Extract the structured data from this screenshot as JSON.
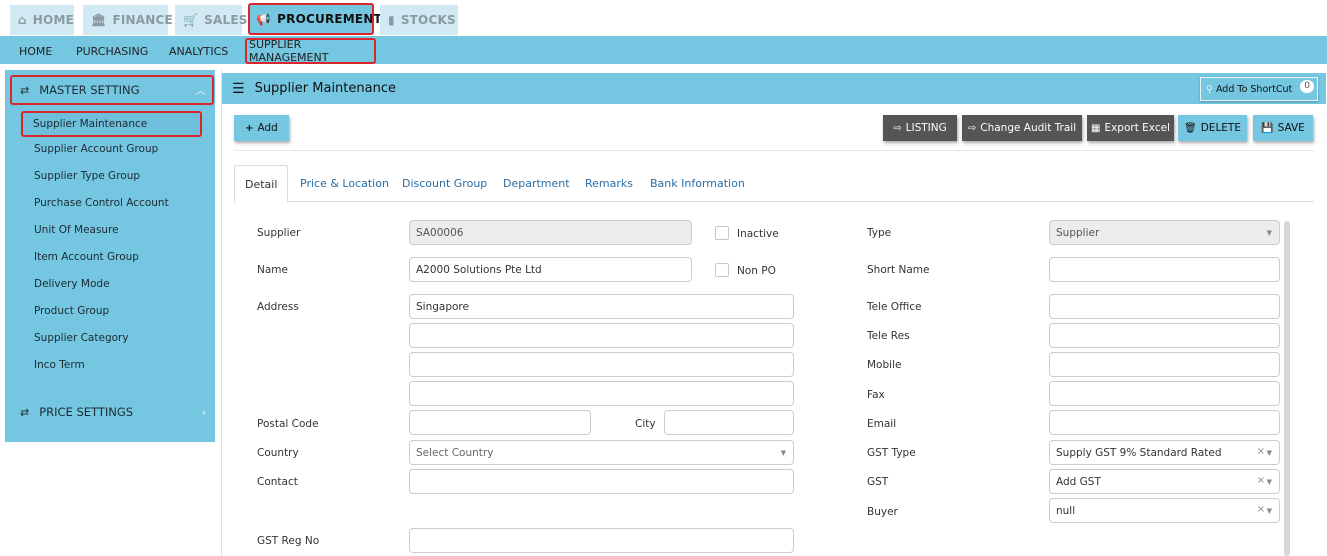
{
  "top_tabs": [
    {
      "icon": "⌂",
      "label": "HOME"
    },
    {
      "icon": "🏛",
      "label": "FINANCE"
    },
    {
      "icon": "🛒",
      "label": "SALES"
    },
    {
      "icon": "📢",
      "label": "PROCUREMENT"
    },
    {
      "icon": "▮",
      "label": "STOCKS"
    }
  ],
  "sub_tabs": [
    "HOME",
    "PURCHASING",
    "ANALYTICS",
    "SUPPLIER MANAGEMENT"
  ],
  "sidebar": {
    "master_setting": "MASTER SETTING",
    "items": [
      "Supplier Maintenance",
      "Supplier Account Group",
      "Supplier Type Group",
      "Purchase Control Account",
      "Unit Of Measure",
      "Item Account Group",
      "Delivery Mode",
      "Product Group",
      "Supplier Category",
      "Inco Term"
    ],
    "price_settings": "PRICE SETTINGS"
  },
  "main": {
    "title": "Supplier Maintenance",
    "shortcut_label": "Add To ShortCut",
    "shortcut_count": "0",
    "add_label": "Add",
    "listing_label": "LISTING",
    "audit_label": "Change Audit Trail",
    "export_label": "Export Excel",
    "delete_label": "DELETE",
    "save_label": "SAVE"
  },
  "form_tabs": [
    "Detail",
    "Price & Location",
    "Discount Group",
    "Department",
    "Remarks",
    "Bank Information"
  ],
  "form": {
    "supplier_label": "Supplier",
    "supplier_value": "SA00006",
    "inactive_label": "Inactive",
    "name_label": "Name",
    "name_value": "A2000 Solutions Pte Ltd",
    "nonpo_label": "Non PO",
    "address_label": "Address",
    "address_lines": [
      "Singapore",
      "",
      "",
      ""
    ],
    "postal_label": "Postal Code",
    "postal_value": "",
    "city_label": "City",
    "city_value": "",
    "country_label": "Country",
    "country_placeholder": "Select Country",
    "contact_label": "Contact",
    "contact_value": "",
    "gstreg_label": "GST Reg No",
    "gstreg_value": "",
    "type_label": "Type",
    "type_value": "Supplier",
    "shortname_label": "Short Name",
    "teleoffice_label": "Tele Office",
    "teleres_label": "Tele Res",
    "mobile_label": "Mobile",
    "fax_label": "Fax",
    "email_label": "Email",
    "gsttype_label": "GST Type",
    "gsttype_value": "Supply GST 9% Standard Rated",
    "gst_label": "GST",
    "gst_value": "Add GST",
    "buyer_label": "Buyer",
    "buyer_value": "null"
  }
}
